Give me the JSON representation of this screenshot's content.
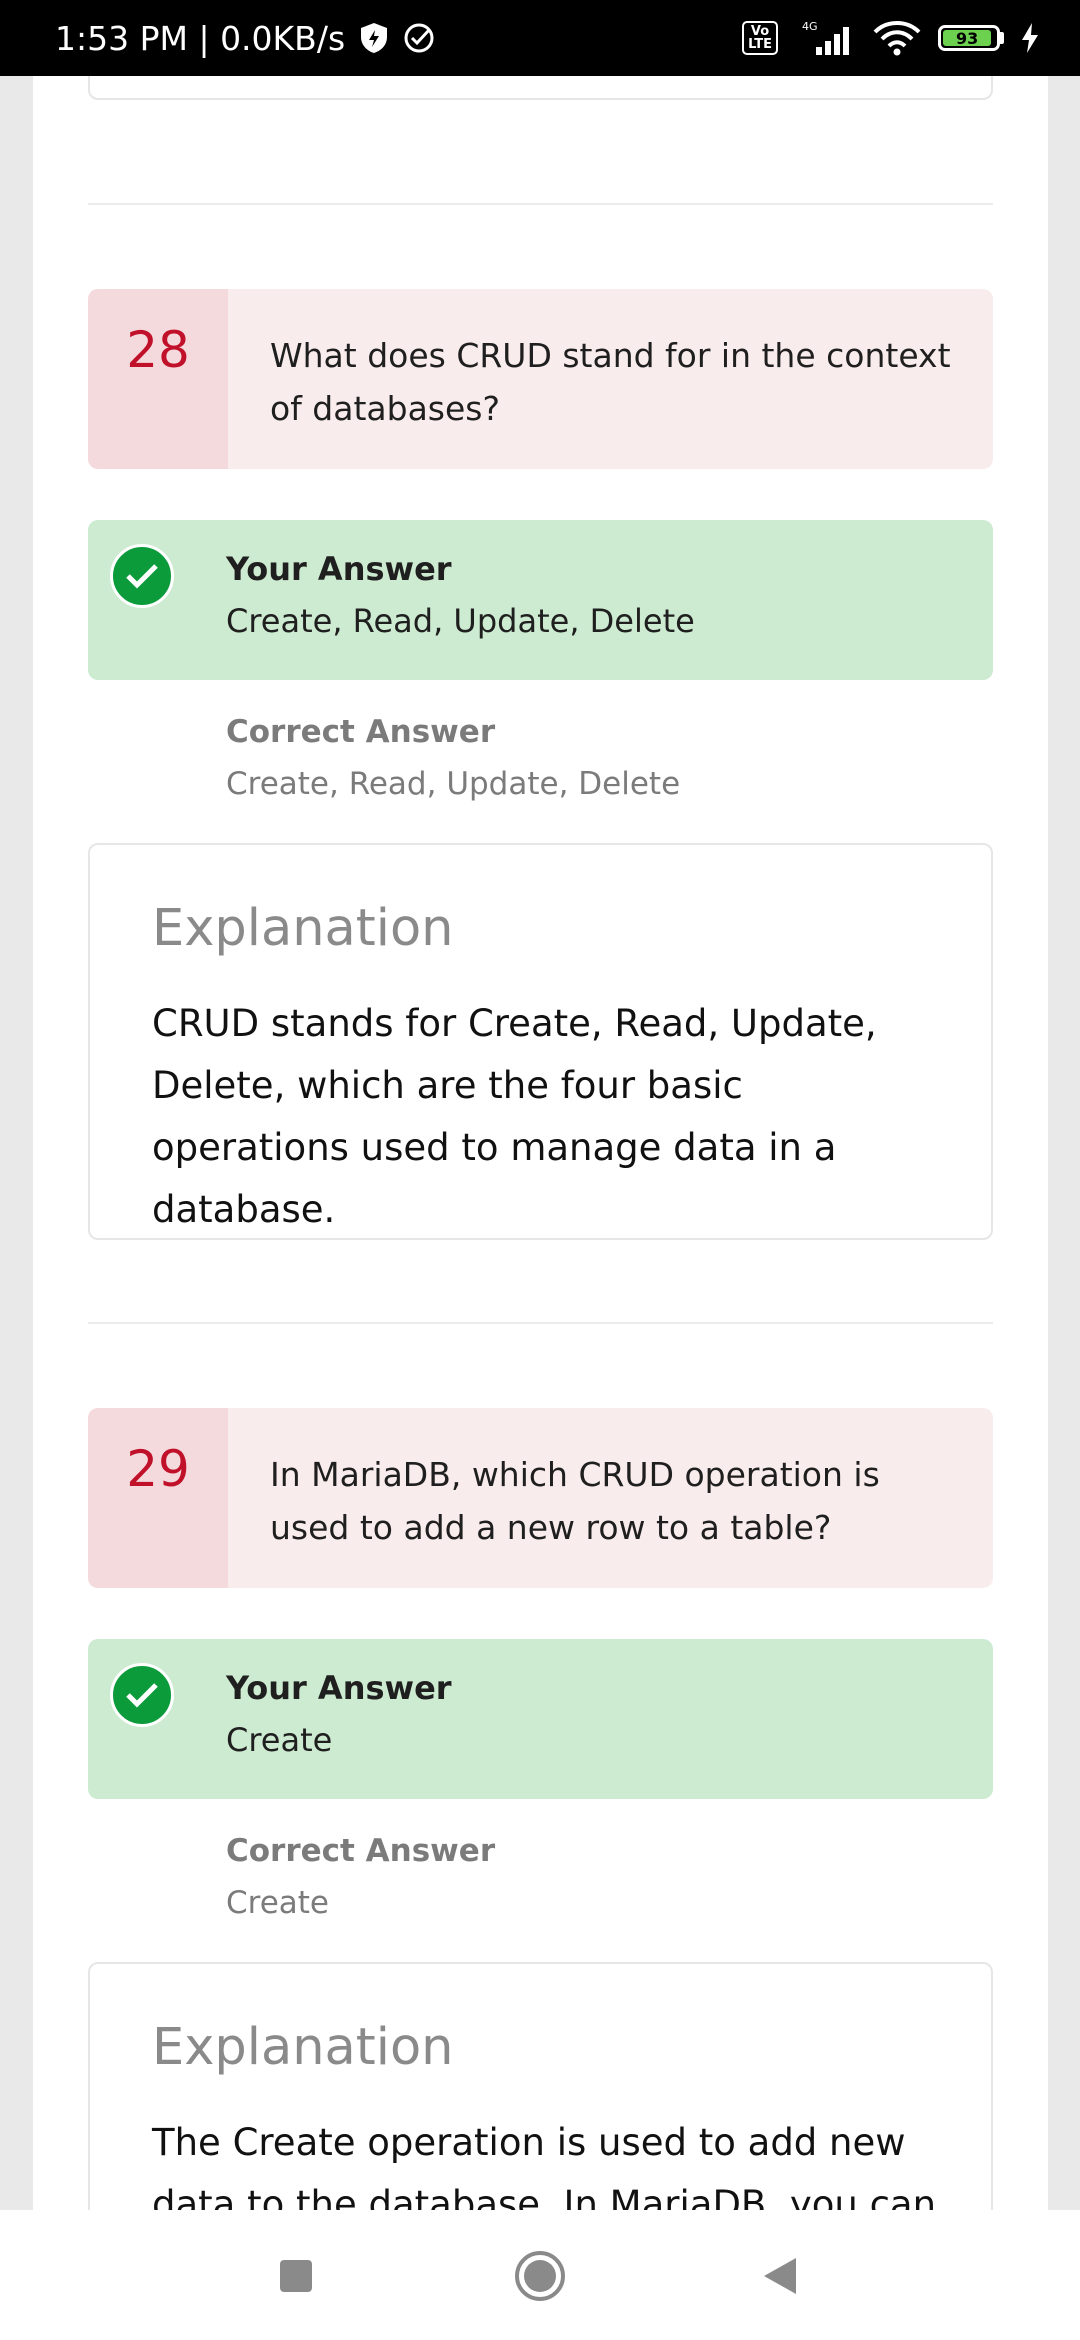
{
  "status_bar": {
    "time_speed": "1:53 PM | 0.0KB/s",
    "volte": "Vo\nLTE",
    "network": "4G",
    "battery": "93"
  },
  "questions": [
    {
      "number": "28",
      "text": "What does CRUD stand for in the context of databases?",
      "your_answer_label": "Your Answer",
      "your_answer": "Create, Read, Update, Delete",
      "correct_answer_label": "Correct Answer",
      "correct_answer": "Create, Read, Update, Delete",
      "explanation_title": "Explanation",
      "explanation": "CRUD stands for Create, Read, Update, Delete, which are the four basic operations used to manage data in a database."
    },
    {
      "number": "29",
      "text": "In MariaDB, which CRUD operation is used to add a new row to a table?",
      "your_answer_label": "Your Answer",
      "your_answer": "Create",
      "correct_answer_label": "Correct Answer",
      "correct_answer": "Create",
      "explanation_title": "Explanation",
      "explanation": "The Create operation is used to add new data to the database. In MariaDB, you can"
    }
  ],
  "colors": {
    "question_bg": "#f9ecec",
    "question_num_bg": "#f5dadd",
    "question_num": "#c0102a",
    "answer_bg": "#cdebd1",
    "check": "#0c9b3b"
  },
  "icons": {
    "shield": "shield-icon",
    "check_circle": "check-circle-icon",
    "signal": "signal-icon",
    "wifi": "wifi-icon",
    "battery": "battery-icon",
    "charging": "charging-icon",
    "nav_recents": "recents-icon",
    "nav_home": "home-icon",
    "nav_back": "back-icon"
  }
}
